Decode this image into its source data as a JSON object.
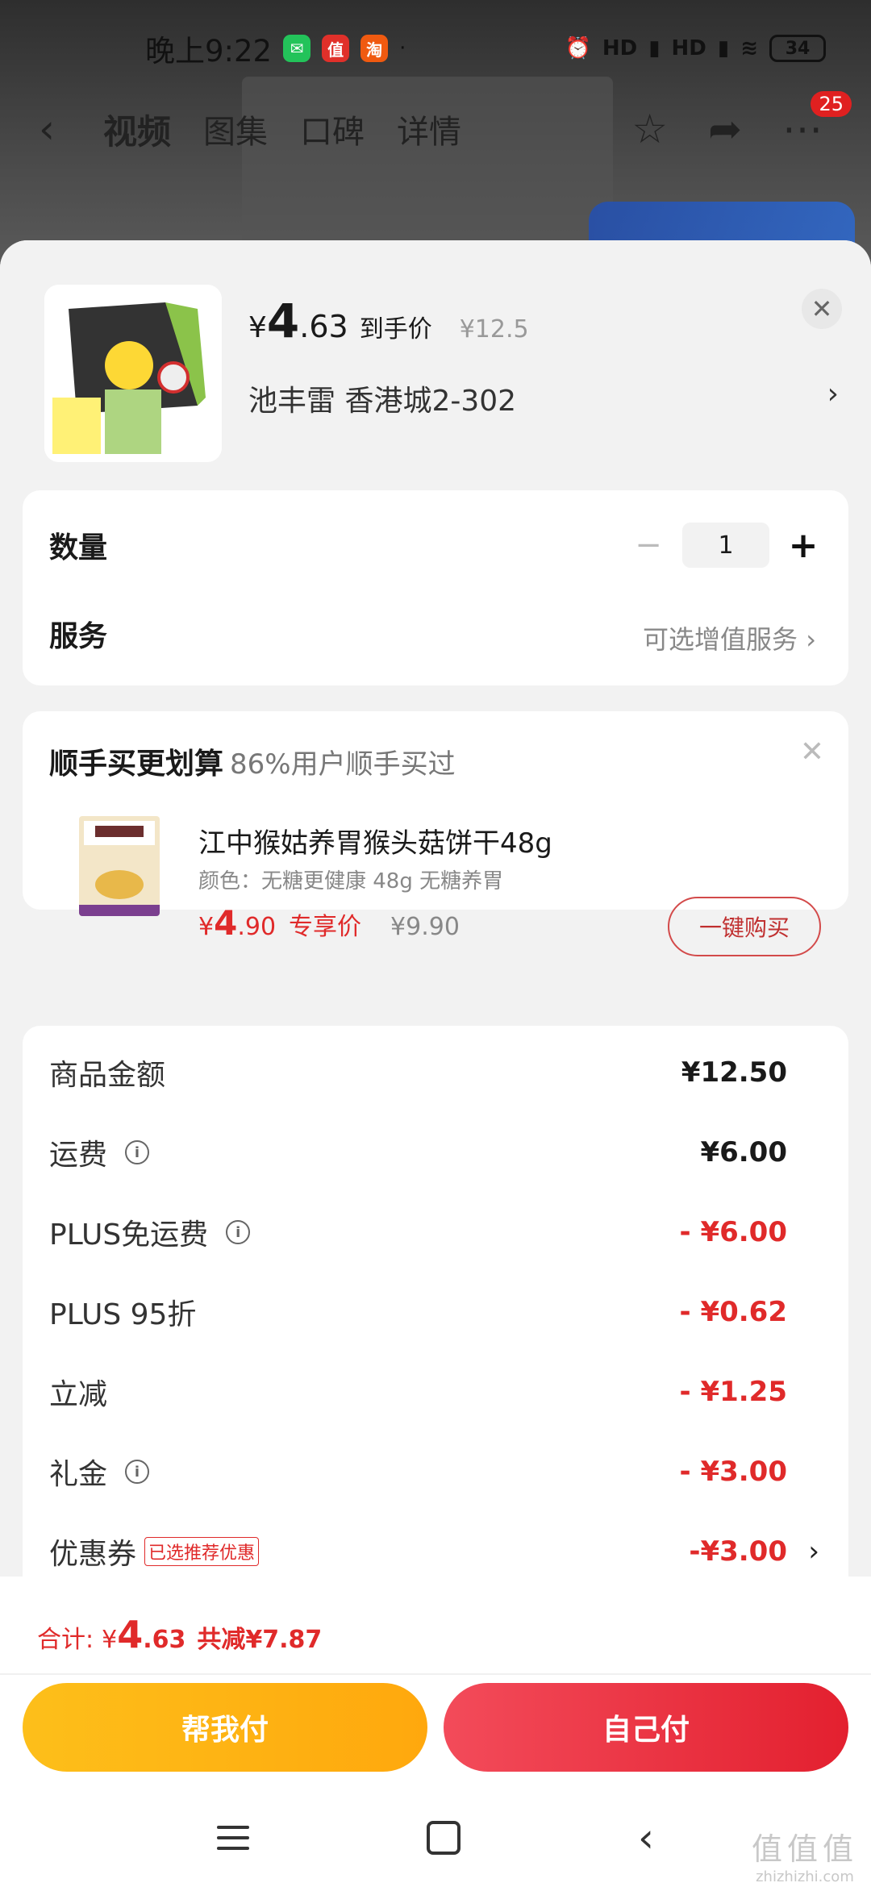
{
  "status_bar": {
    "time": "晚上9:22",
    "apps": [
      "wechat-icon",
      "zhidemai-icon",
      "taobao-icon"
    ],
    "signal1": "HD",
    "signal2": "HD",
    "battery": "34"
  },
  "nav": {
    "tabs": [
      "视频",
      "图集",
      "口碑",
      "详情"
    ],
    "active_tab": "视频",
    "badge": "25"
  },
  "product": {
    "price_symbol": "¥",
    "price_int": "4",
    "price_dec": ".63",
    "price_label": "到手价",
    "orig_price": "¥12.5",
    "address": "池丰雷  香港城2-302"
  },
  "quantity": {
    "label": "数量",
    "value": "1"
  },
  "service": {
    "label": "服务",
    "value": "可选增值服务"
  },
  "upsell": {
    "title": "顺手买更划算",
    "subtitle": "86%用户顺手买过",
    "name": "江中猴姑养胃猴头菇饼干48g",
    "spec": "颜色：无糖更健康 48g 无糖养胃",
    "price_symbol": "¥",
    "price_int": "4",
    "price_dec": ".90",
    "price_tag": "专享价",
    "orig_price": "¥9.90",
    "buy_label": "一键购买"
  },
  "summary": {
    "rows": [
      {
        "label": "商品金额",
        "value": "¥12.50"
      },
      {
        "label": "运费",
        "value": "¥6.00"
      },
      {
        "label": "PLUS免运费",
        "value": "- ¥6.00"
      },
      {
        "label": "PLUS 95折",
        "value": "- ¥0.62"
      },
      {
        "label": "立减",
        "value": "- ¥1.25"
      },
      {
        "label": "礼金",
        "value": "- ¥3.00"
      },
      {
        "label": "优惠券",
        "value": "-¥3.00",
        "tag": "已选推荐优惠"
      }
    ]
  },
  "bottom": {
    "total_label": "合计:",
    "total_symbol": "¥",
    "total_int": "4",
    "total_dec": ".63",
    "saved": "共减¥7.87",
    "help_pay": "帮我付",
    "self_pay": "自己付"
  },
  "watermark": {
    "big": "值值值",
    "small": "zhizhizhi.com"
  },
  "colors": {
    "accent_red": "#e02a2a",
    "help_pay": "#ffb30f",
    "self_pay": "#eb3341"
  }
}
